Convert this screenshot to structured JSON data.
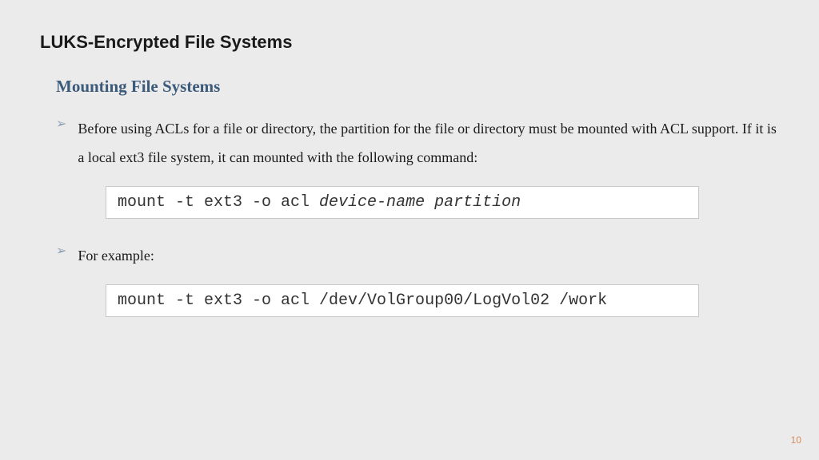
{
  "title": "LUKS-Encrypted File Systems",
  "section": "Mounting File Systems",
  "bullets": {
    "item1": "Before using ACLs for a file or directory, the partition for the file or directory must be mounted with ACL support. If it is a local ext3 file system, it can mounted with the following command:",
    "item2": "For example:"
  },
  "code": {
    "block1_prefix": "mount -t ext3 -o acl ",
    "block1_italic": "device-name partition",
    "block2": "mount -t ext3 -o acl /dev/VolGroup00/LogVol02 /work"
  },
  "page_number": "10"
}
